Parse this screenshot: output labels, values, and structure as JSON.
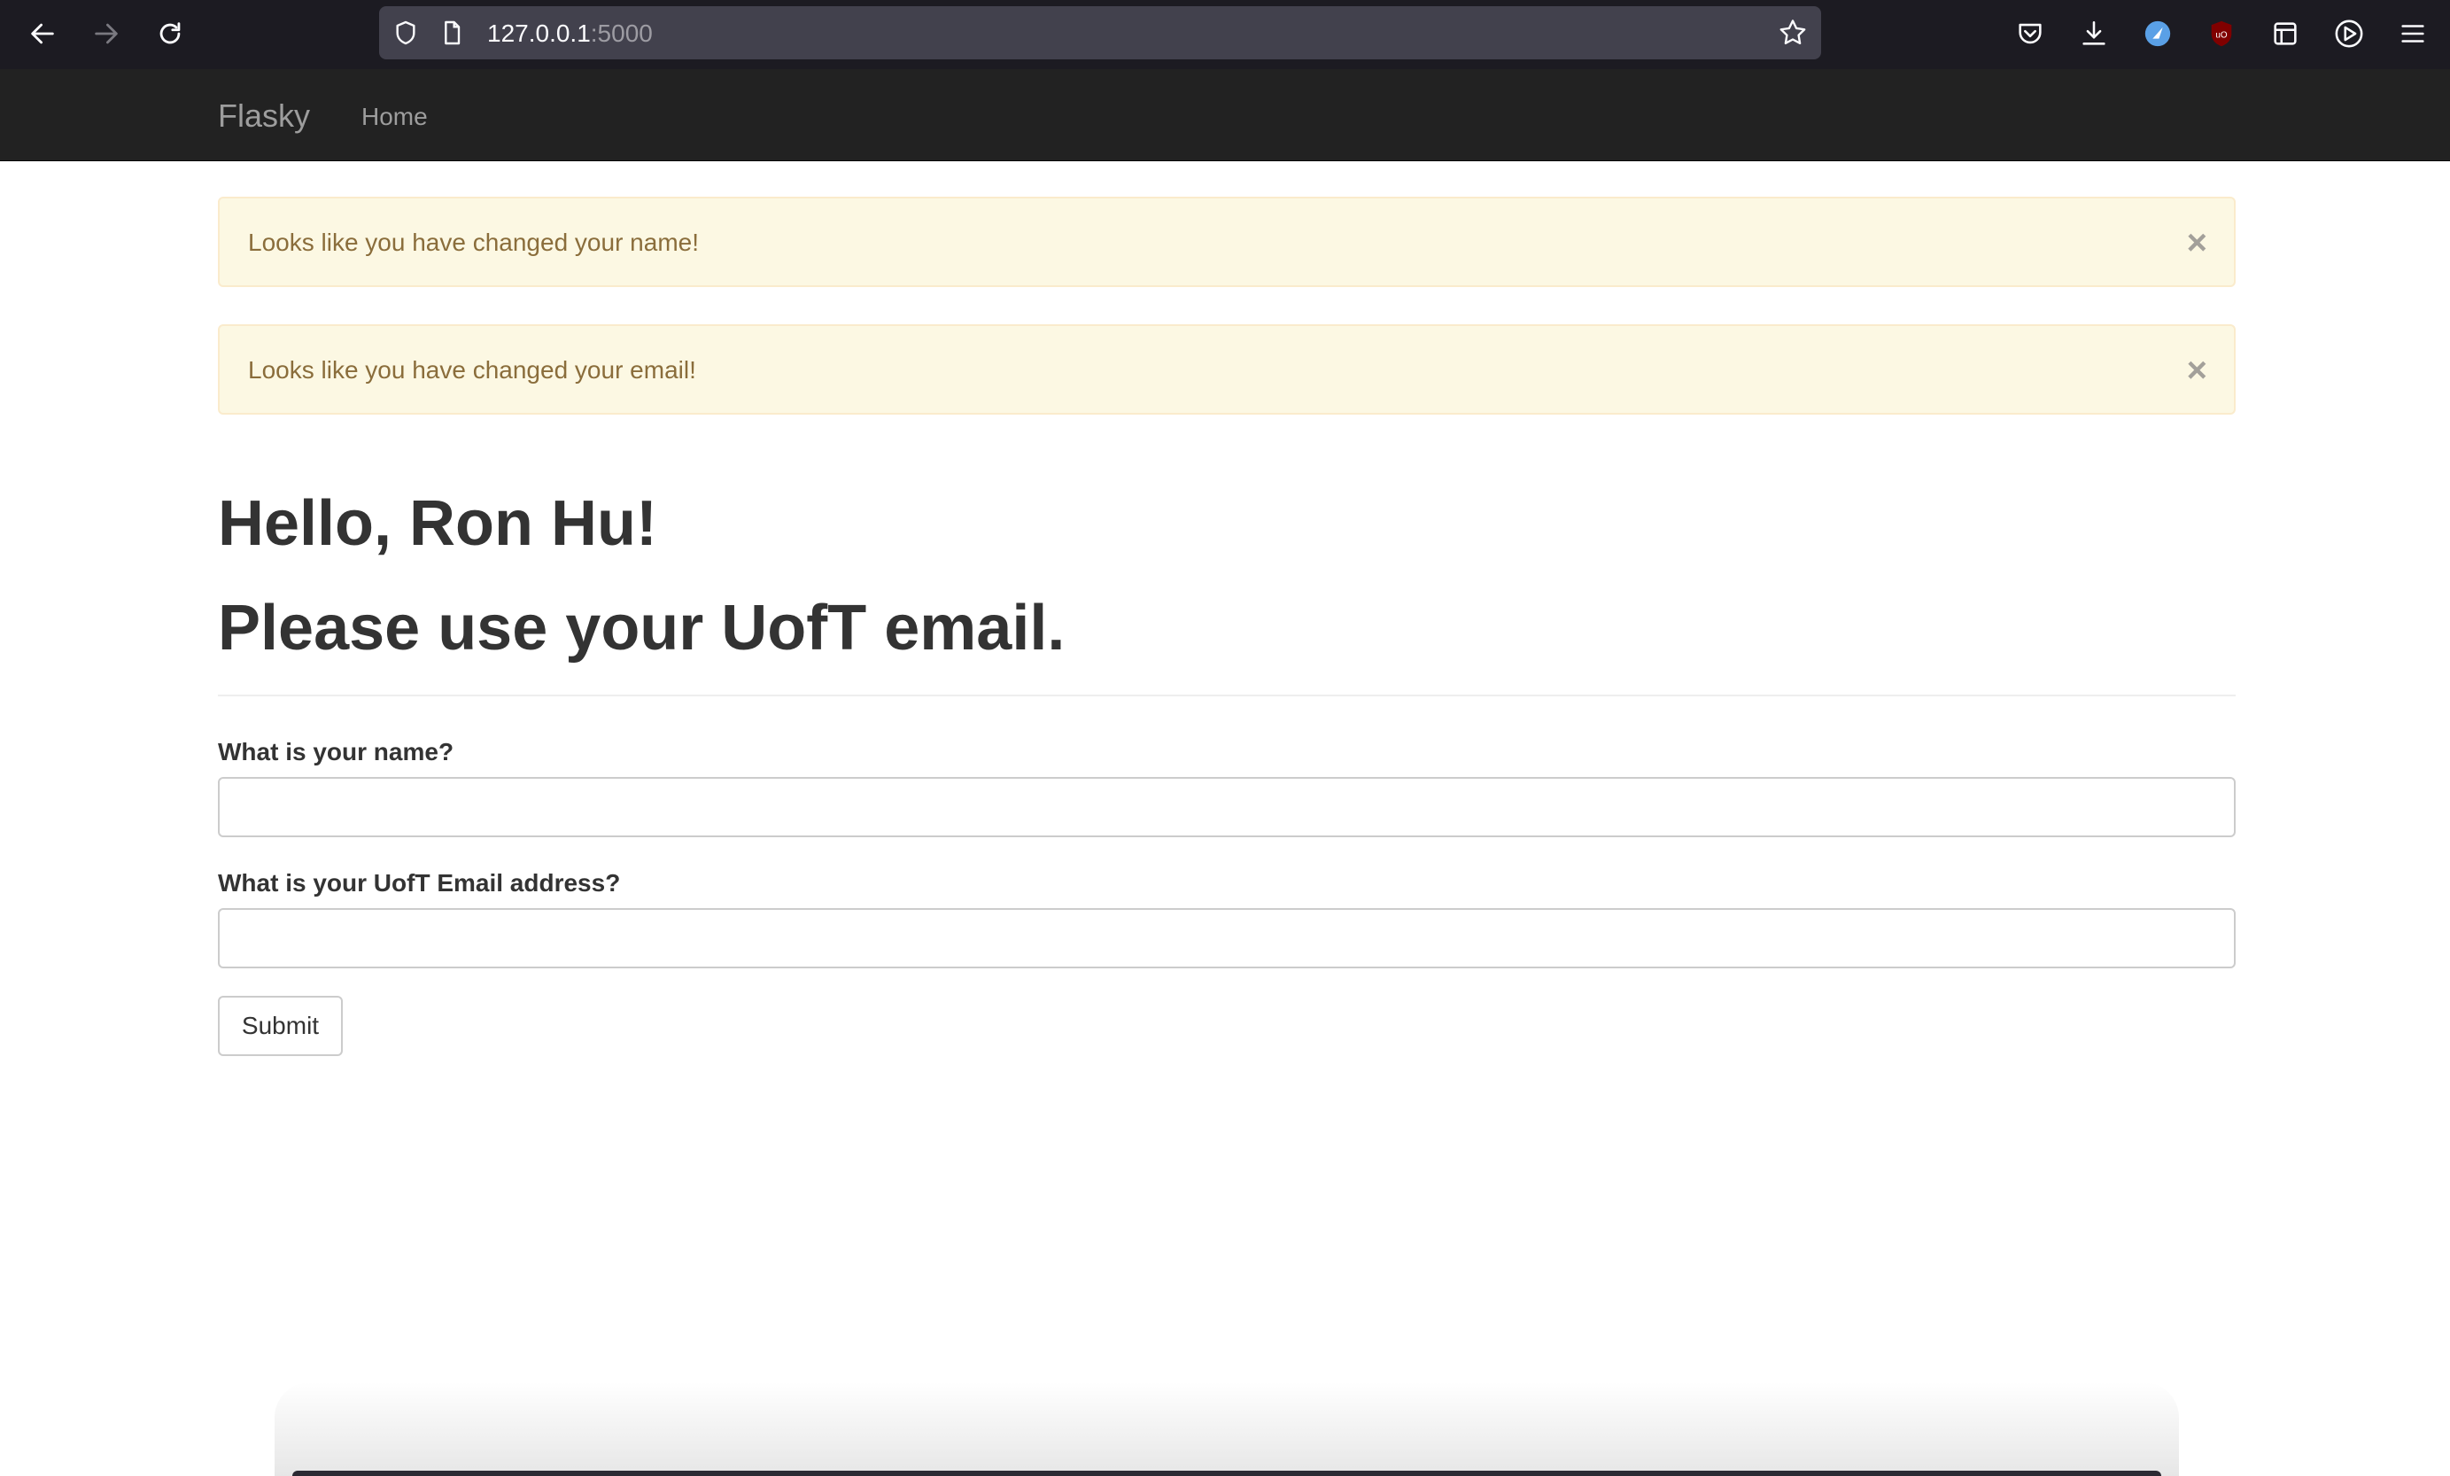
{
  "browser": {
    "url_host": "127.0.0.1",
    "url_port": ":5000"
  },
  "navbar": {
    "brand": "Flasky",
    "home": "Home"
  },
  "alerts": [
    {
      "text": "Looks like you have changed your name!",
      "close": "×"
    },
    {
      "text": "Looks like you have changed your email!",
      "close": "×"
    }
  ],
  "page": {
    "greeting": "Hello, Ron Hu!",
    "instruction": "Please use your UofT email."
  },
  "form": {
    "name_label": "What is your name?",
    "name_value": "",
    "email_label": "What is your UofT Email address?",
    "email_value": "",
    "submit_label": "Submit"
  },
  "colors": {
    "navbar_bg": "#222222",
    "alert_bg": "#fcf8e3",
    "alert_text": "#8a6d3b",
    "heading": "#333333"
  }
}
